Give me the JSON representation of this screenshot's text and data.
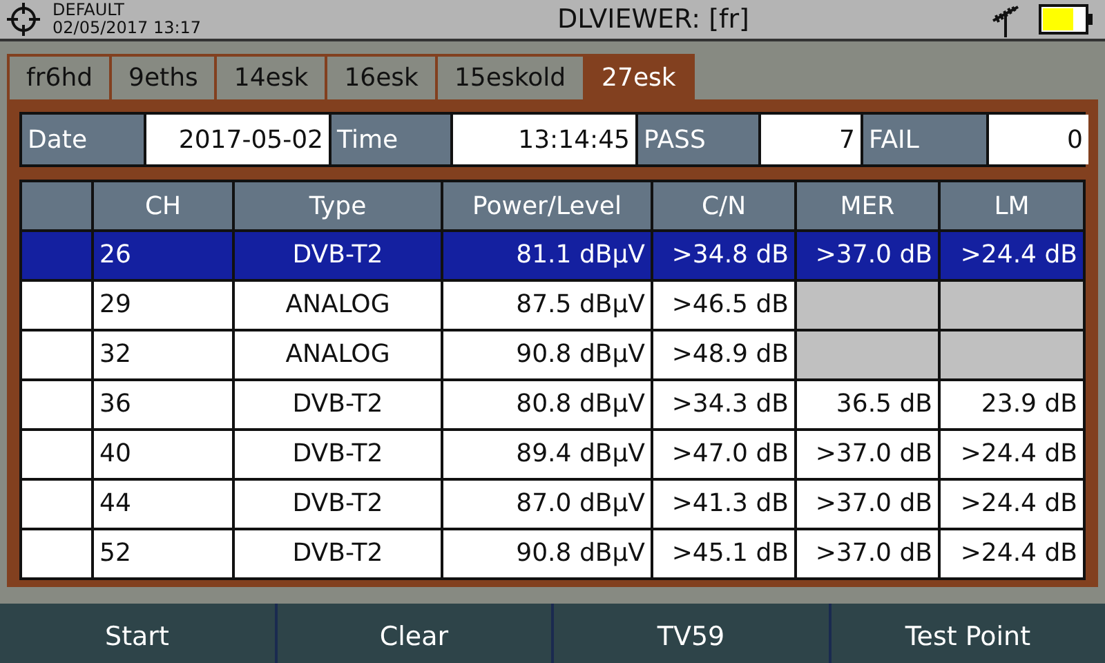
{
  "status": {
    "profile": "DEFAULT",
    "datetime": "02/05/2017 13:17"
  },
  "window": {
    "title": "DLVIEWER: [fr]"
  },
  "tabs": [
    {
      "label": "fr6hd",
      "selected": false
    },
    {
      "label": "9eths",
      "selected": false
    },
    {
      "label": "14esk",
      "selected": false
    },
    {
      "label": "16esk",
      "selected": false
    },
    {
      "label": "15eskold",
      "selected": false
    },
    {
      "label": "27esk",
      "selected": true
    }
  ],
  "summary": [
    {
      "label": "Date",
      "value": "2017-05-02"
    },
    {
      "label": "Time",
      "value": "13:14:45"
    },
    {
      "label": "PASS",
      "value": "7"
    },
    {
      "label": "FAIL",
      "value": "0"
    }
  ],
  "table": {
    "columns": [
      "CH",
      "Type",
      "Power/Level",
      "C/N",
      "MER",
      "LM"
    ],
    "rows": [
      {
        "selected": true,
        "ch": "26",
        "type": "DVB-T2",
        "power": "81.1 dBµV",
        "cn": ">34.8 dB",
        "mer": ">37.0 dB",
        "lm": ">24.4 dB"
      },
      {
        "selected": false,
        "ch": "29",
        "type": "ANALOG",
        "power": "87.5 dBµV",
        "cn": ">46.5 dB"
      },
      {
        "selected": false,
        "ch": "32",
        "type": "ANALOG",
        "power": "90.8 dBµV",
        "cn": ">48.9 dB"
      },
      {
        "selected": false,
        "ch": "36",
        "type": "DVB-T2",
        "power": "80.8 dBµV",
        "cn": ">34.3 dB",
        "mer": "36.5 dB",
        "lm": "23.9 dB"
      },
      {
        "selected": false,
        "ch": "40",
        "type": "DVB-T2",
        "power": "89.4 dBµV",
        "cn": ">47.0 dB",
        "mer": ">37.0 dB",
        "lm": ">24.4 dB"
      },
      {
        "selected": false,
        "ch": "44",
        "type": "DVB-T2",
        "power": "87.0 dBµV",
        "cn": ">41.3 dB",
        "mer": ">37.0 dB",
        "lm": ">24.4 dB"
      },
      {
        "selected": false,
        "ch": "52",
        "type": "DVB-T2",
        "power": "90.8 dBµV",
        "cn": ">45.1 dB",
        "mer": ">37.0 dB",
        "lm": ">24.4 dB"
      }
    ]
  },
  "buttons": [
    "Start",
    "Clear",
    "TV59",
    "Test Point"
  ]
}
